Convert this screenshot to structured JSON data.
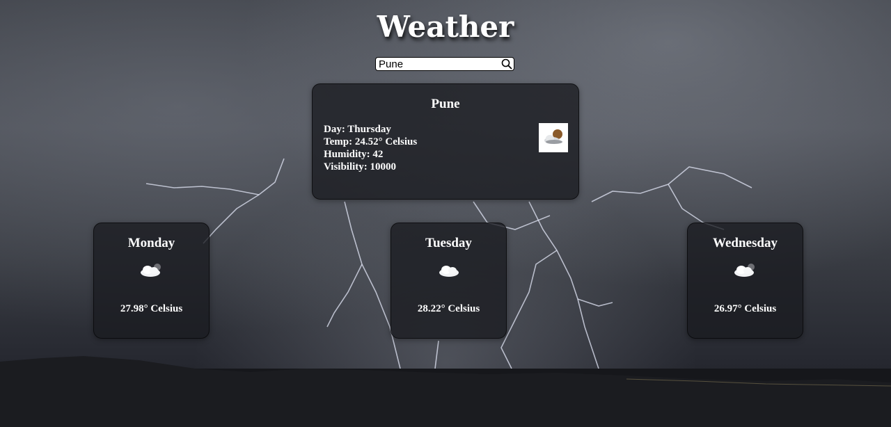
{
  "header": {
    "title": "Weather"
  },
  "search": {
    "value": "Pune",
    "placeholder": ""
  },
  "current": {
    "city": "Pune",
    "day": "Day: Thursday",
    "temp": "Temp: 24.52° Celsius",
    "humidity": "Humidity: 42",
    "visibility": "Visibility: 10000",
    "icon": "partly-cloudy-icon"
  },
  "forecast": [
    {
      "day": "Monday",
      "temp": "27.98° Celsius",
      "icon": "partly-cloudy-icon"
    },
    {
      "day": "Tuesday",
      "temp": "28.22° Celsius",
      "icon": "cloud-icon"
    },
    {
      "day": "Wednesday",
      "temp": "26.97° Celsius",
      "icon": "partly-cloudy-icon"
    }
  ],
  "colors": {
    "card_bg": "#1a1b20",
    "text": "#ffffff",
    "sky": "#4a4d55"
  }
}
